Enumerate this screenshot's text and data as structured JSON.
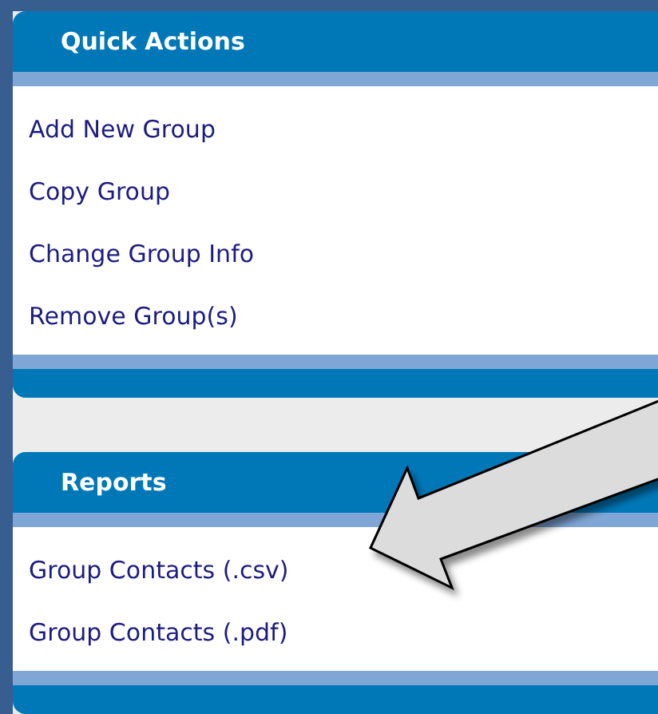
{
  "panels": [
    {
      "title": "Quick Actions",
      "links": [
        "Add New Group",
        "Copy Group",
        "Change Group Info",
        "Remove Group(s)"
      ]
    },
    {
      "title": "Reports",
      "links": [
        "Group Contacts (.csv)",
        "Group Contacts (.pdf)"
      ]
    }
  ]
}
